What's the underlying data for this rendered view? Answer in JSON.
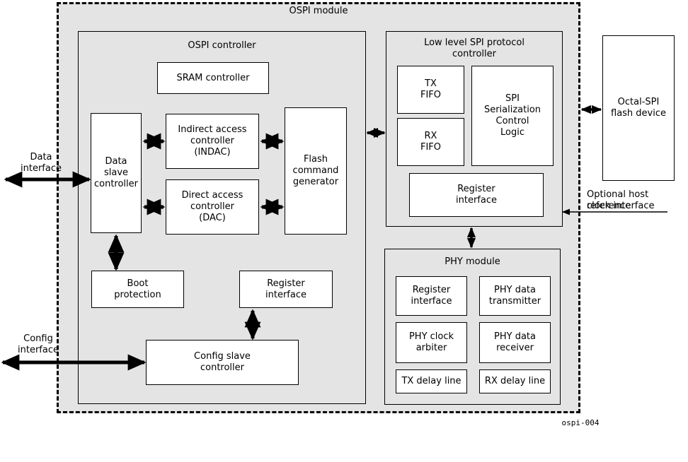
{
  "diagram": {
    "tag": "ospi-004",
    "outer_module_title": "OSPI module",
    "colors": {
      "module_fill": "#e4e4e4",
      "block_fill": "#ffffff",
      "line": "#000000",
      "page": "#ffffff"
    }
  },
  "ospi_controller": {
    "title": "OSPI controller",
    "blocks": {
      "sram_controller": "SRAM controller",
      "data_slave_controller": "Data\nslave\ncontroller",
      "data_slave_controller_l1": "Data",
      "data_slave_controller_l2": "slave",
      "data_slave_controller_l3": "controller",
      "indirect_access_l1": "Indirect access",
      "indirect_access_l2": "controller",
      "indirect_access_l3": "(INDAC)",
      "direct_access_l1": "Direct access",
      "direct_access_l2": "controller",
      "direct_access_l3": "(DAC)",
      "flash_command_l1": "Flash",
      "flash_command_l2": "command",
      "flash_command_l3": "generator",
      "boot_protection_l1": "Boot",
      "boot_protection_l2": "protection",
      "register_interface_l1": "Register",
      "register_interface_l2": "interface",
      "config_slave_l1": "Config slave",
      "config_slave_l2": "controller"
    }
  },
  "low_level_spi": {
    "title_l1": "Low level SPI protocol",
    "title_l2": "controller",
    "blocks": {
      "tx_fifo_l1": "TX",
      "tx_fifo_l2": "FIFO",
      "rx_fifo_l1": "RX",
      "rx_fifo_l2": "FIFO",
      "spi_serialization_l1": "SPI",
      "spi_serialization_l2": "Serialization",
      "spi_serialization_l3": "Control",
      "spi_serialization_l4": "Logic",
      "register_interface_l1": "Register",
      "register_interface_l2": "interface"
    }
  },
  "phy_module": {
    "title": "PHY module",
    "blocks": {
      "register_interface_l1": "Register",
      "register_interface_l2": "interface",
      "phy_data_transmitter_l1": "PHY data",
      "phy_data_transmitter_l2": "transmitter",
      "phy_clock_arbiter_l1": "PHY clock",
      "phy_clock_arbiter_l2": "arbiter",
      "phy_data_receiver_l1": "PHY data",
      "phy_data_receiver_l2": "receiver",
      "tx_delay_line": "TX delay line",
      "rx_delay_line": "RX delay line"
    }
  },
  "external": {
    "flash_device_l1": "Octal-SPI",
    "flash_device_l2": "flash device",
    "data_interface_l1": "Data",
    "data_interface_l2": "interface",
    "config_interface_l1": "Config",
    "config_interface_l2": "interface",
    "clock_interface_l1": "Optional host reference",
    "clock_interface_l2": "clock interface"
  }
}
